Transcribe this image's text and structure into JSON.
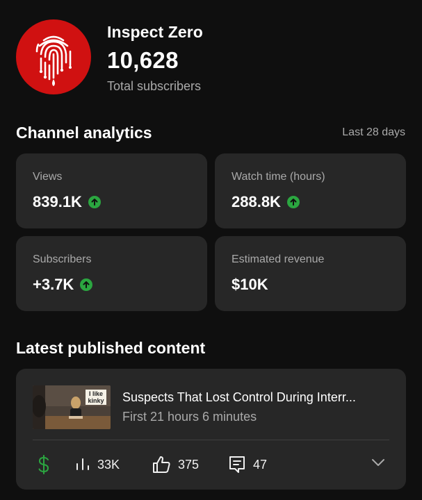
{
  "channel": {
    "name": "Inspect Zero",
    "subscriber_count": "10,628",
    "subscriber_label": "Total subscribers",
    "avatar_icon": "fingerprint-icon",
    "avatar_color": "#d01111"
  },
  "analytics": {
    "title": "Channel analytics",
    "period": "Last 28 days",
    "cards": [
      {
        "label": "Views",
        "value": "839.1K",
        "trend": "up"
      },
      {
        "label": "Watch time (hours)",
        "value": "288.8K",
        "trend": "up"
      },
      {
        "label": "Subscribers",
        "value": "+3.7K",
        "trend": "up"
      },
      {
        "label": "Estimated revenue",
        "value": "$10K",
        "trend": ""
      }
    ],
    "trend_color": "#2ba640"
  },
  "latest": {
    "title": "Latest published content",
    "video": {
      "thumbnail_text": "I like kinky",
      "title": "Suspects That Lost Control During Interr...",
      "meta": "First 21 hours 6 minutes",
      "views": "33K",
      "likes": "375",
      "comments": "47"
    },
    "revenue_icon_color": "#2ba640"
  }
}
